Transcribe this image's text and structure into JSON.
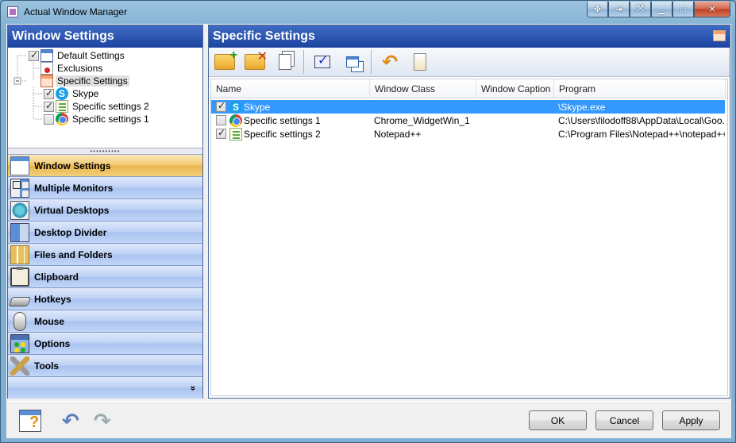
{
  "window": {
    "title": "Actual Window Manager"
  },
  "title_buttons": [
    {
      "name": "pin-to-top-button",
      "glyph": "✥"
    },
    {
      "name": "minimize-to-tray-button",
      "glyph": "⇥"
    },
    {
      "name": "move-to-monitor-button",
      "glyph": "⤧"
    },
    {
      "name": "minimize-button",
      "glyph": "▁"
    },
    {
      "name": "maximize-button",
      "glyph": "□"
    },
    {
      "name": "close-button",
      "glyph": "✕"
    }
  ],
  "left_panel": {
    "title": "Window Settings",
    "tree": [
      {
        "label": "Default Settings",
        "checked": true,
        "icon": "window-icon"
      },
      {
        "label": "Exclusions",
        "icon": "exclusions-icon"
      },
      {
        "label": "Specific Settings",
        "icon": "specific-settings-icon"
      },
      {
        "label": "Skype",
        "checked": true,
        "icon": "skype-icon"
      },
      {
        "label": "Specific settings 2",
        "checked": true,
        "icon": "notepad-icon"
      },
      {
        "label": "Specific settings 1",
        "checked": false,
        "icon": "chrome-icon"
      }
    ],
    "nav": [
      {
        "label": "Window Settings",
        "active": true
      },
      {
        "label": "Multiple Monitors"
      },
      {
        "label": "Virtual Desktops"
      },
      {
        "label": "Desktop Divider"
      },
      {
        "label": "Files and Folders"
      },
      {
        "label": "Clipboard"
      },
      {
        "label": "Hotkeys"
      },
      {
        "label": "Mouse"
      },
      {
        "label": "Options"
      },
      {
        "label": "Tools"
      }
    ],
    "nav_more": "»"
  },
  "right_panel": {
    "title": "Specific Settings",
    "columns": [
      "Name",
      "Window Class",
      "Window Caption",
      "Program"
    ],
    "rows": [
      {
        "name": "Skype",
        "window_class": "",
        "window_caption": "",
        "program": "\\Skype.exe",
        "checked": true,
        "selected": true
      },
      {
        "name": "Specific settings 1",
        "window_class": "Chrome_WidgetWin_1",
        "window_caption": "",
        "program": "C:\\Users\\filodoff88\\AppData\\Local\\Goo...",
        "checked": false,
        "selected": false
      },
      {
        "name": "Specific settings 2",
        "window_class": "Notepad++",
        "window_caption": "",
        "program": "C:\\Program Files\\Notepad++\\notepad++...",
        "checked": true,
        "selected": false
      }
    ]
  },
  "buttons": {
    "ok": "OK",
    "cancel": "Cancel",
    "apply": "Apply"
  }
}
